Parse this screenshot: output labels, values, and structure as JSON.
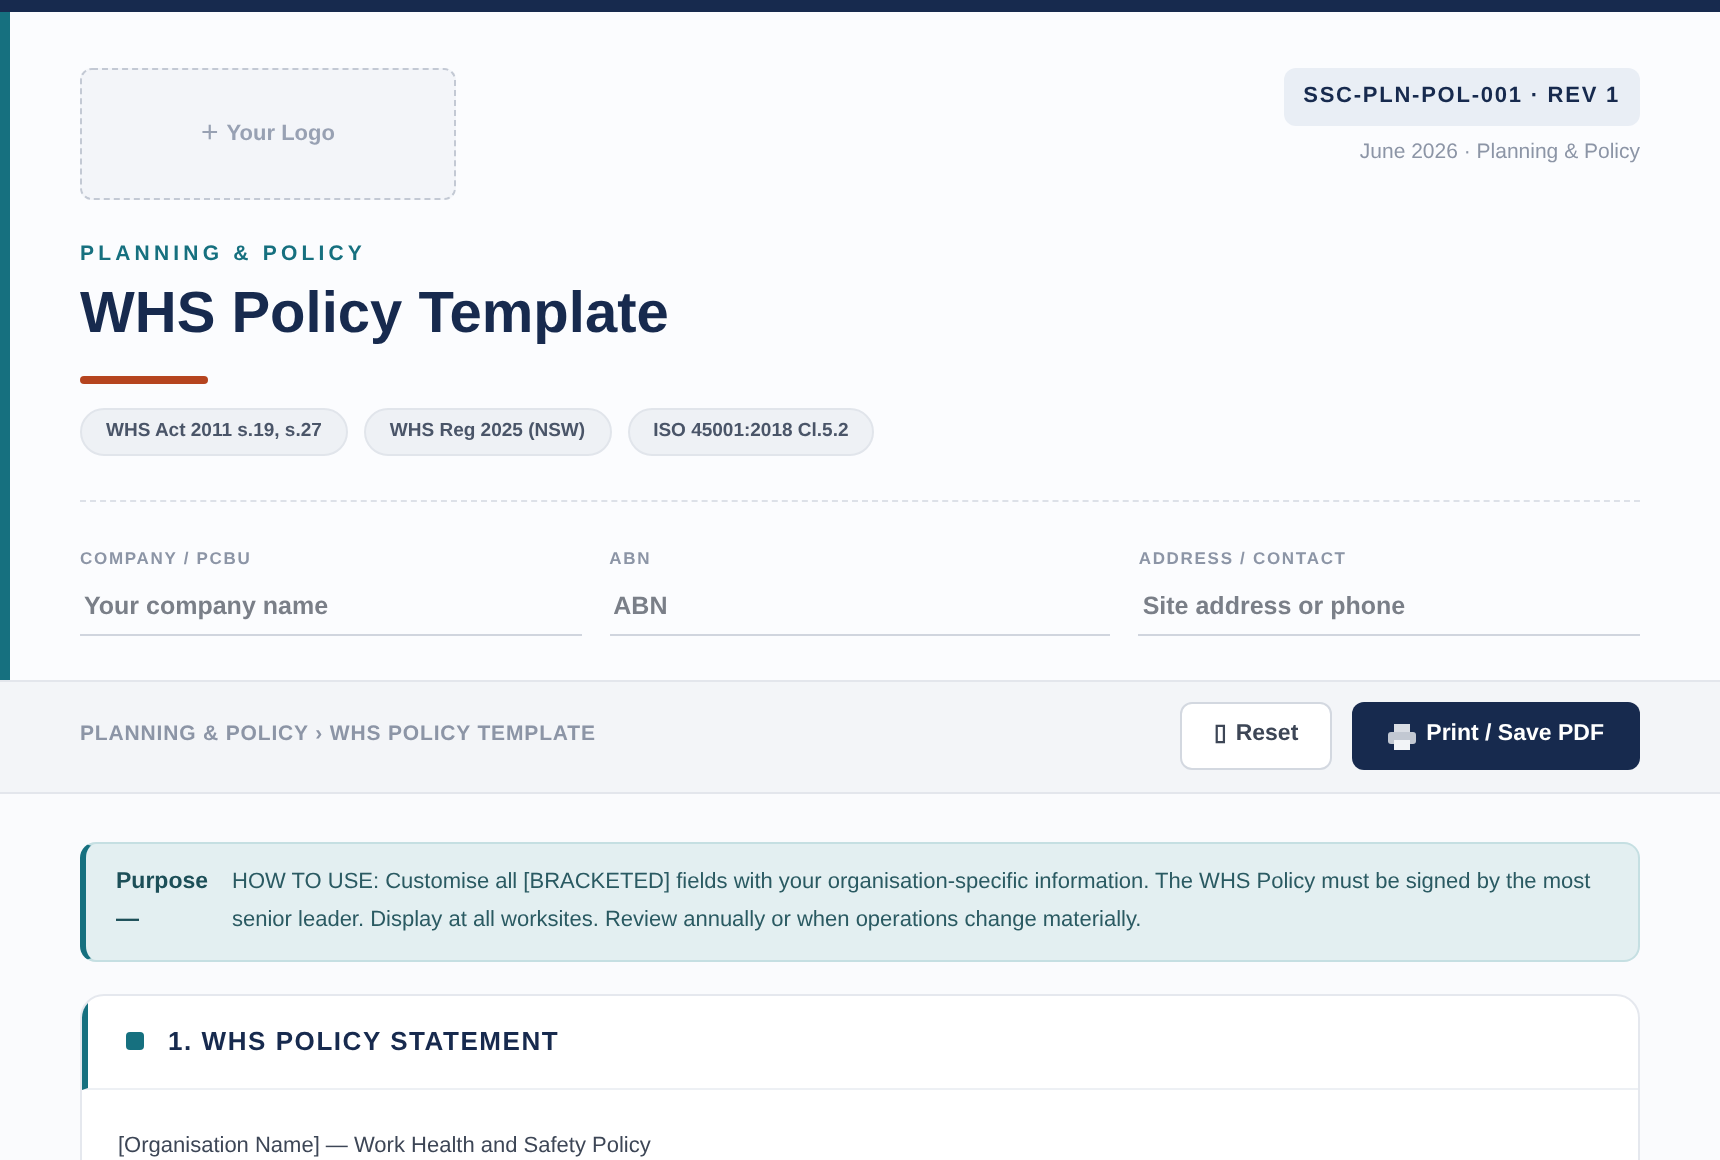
{
  "logo_placeholder": {
    "icon": "+",
    "label": "Your Logo"
  },
  "doc_id": "SSC-PLN-POL-001 · REV 1",
  "doc_meta": "June 2026 · Planning & Policy",
  "category": "PLANNING & POLICY",
  "title": "WHS Policy Template",
  "tags": [
    "WHS Act 2011 s.19, s.27",
    "WHS Reg 2025 (NSW)",
    "ISO 45001:2018 Cl.5.2"
  ],
  "fields": [
    {
      "label": "COMPANY / PCBU",
      "placeholder": "Your company name"
    },
    {
      "label": "ABN",
      "placeholder": "ABN"
    },
    {
      "label": "ADDRESS / CONTACT",
      "placeholder": "Site address or phone"
    }
  ],
  "breadcrumb": "PLANNING & POLICY › WHS POLICY TEMPLATE",
  "buttons": [
    {
      "kind": "secondary",
      "icon": "▯",
      "label": "Reset"
    },
    {
      "kind": "primary",
      "label": "Print / Save PDF"
    }
  ],
  "purpose": {
    "label": "Purpose —",
    "text": "HOW TO USE: Customise all [BRACKETED] fields with your organisation-specific information. The WHS Policy must be signed by the most senior leader. Display at all worksites. Review annually or when operations change materially."
  },
  "sections": [
    {
      "title": "1. WHS POLICY STATEMENT",
      "body": "[Organisation Name] — Work Health and Safety Policy"
    }
  ]
}
